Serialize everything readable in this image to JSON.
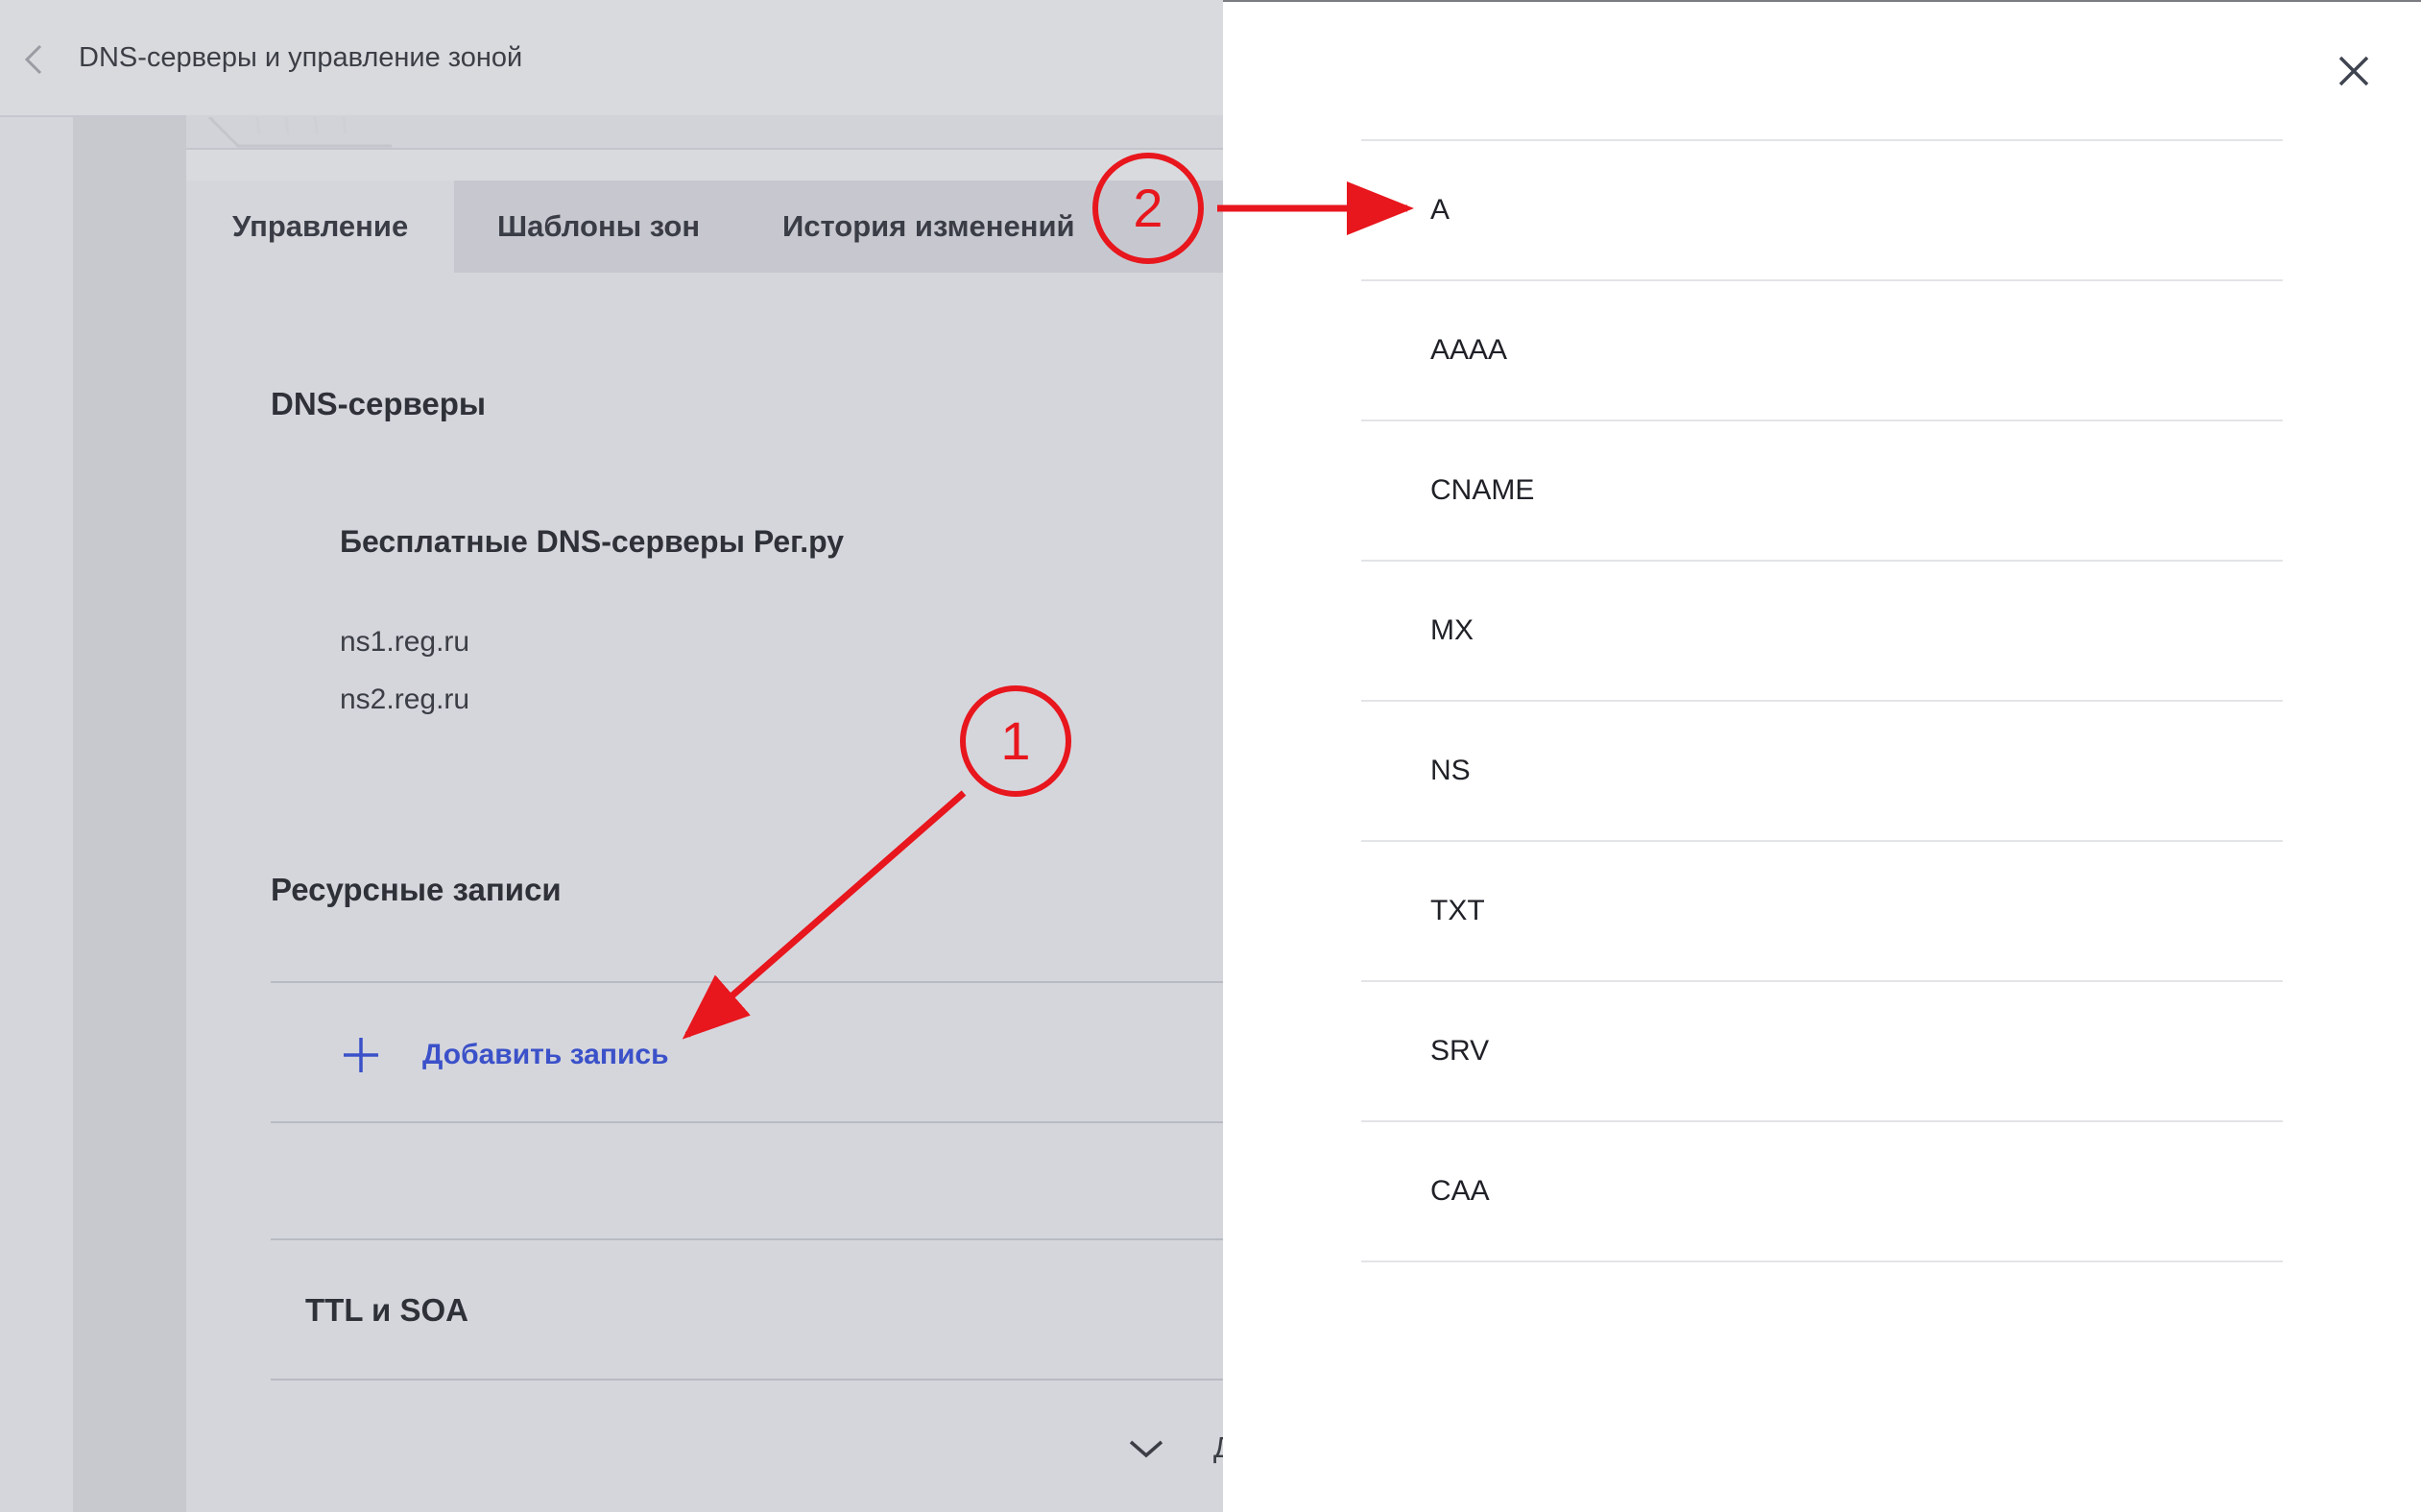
{
  "header": {
    "title": "DNS-серверы и управление зоной"
  },
  "tabs": [
    {
      "label": "Управление",
      "active": true
    },
    {
      "label": "Шаблоны зон",
      "active": false
    },
    {
      "label": "История изменений",
      "active": false
    }
  ],
  "dns_servers": {
    "section_title": "DNS-серверы",
    "group_title": "Бесплатные DNS-серверы Рег.ру",
    "servers": [
      "ns1.reg.ru",
      "ns2.reg.ru"
    ]
  },
  "resource_records": {
    "section_title": "Ресурсные записи",
    "add_record_label": "Добавить запись"
  },
  "ttl_soa": {
    "section_title": "TTL и SOA"
  },
  "footer": {
    "partial_text": "Д"
  },
  "drawer": {
    "record_types": [
      "A",
      "AAAA",
      "CNAME",
      "MX",
      "NS",
      "TXT",
      "SRV",
      "CAA"
    ]
  },
  "annotations": {
    "markers": [
      "1",
      "2"
    ],
    "color": "#e8161d"
  },
  "colors": {
    "accent": "#3b51c9",
    "overlay_bg": "#d9dade",
    "drawer_bg": "#ffffff"
  },
  "icons": {
    "back": "chevron-left-icon",
    "close": "close-icon",
    "add": "plus-icon",
    "expand": "chevron-down-icon"
  }
}
